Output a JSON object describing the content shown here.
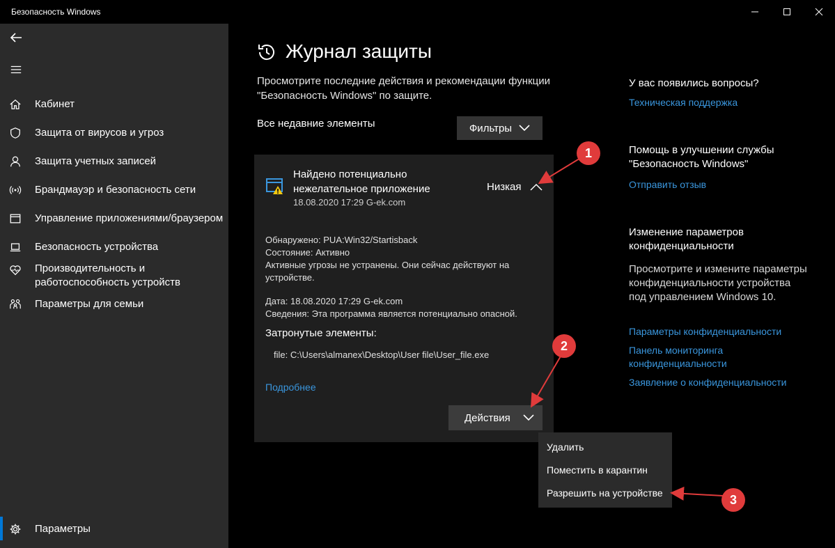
{
  "window": {
    "title": "Безопасность Windows"
  },
  "sidebar": {
    "items": [
      {
        "label": "Кабинет",
        "icon": "home-icon"
      },
      {
        "label": "Защита от вирусов и угроз",
        "icon": "shield-icon"
      },
      {
        "label": "Защита учетных записей",
        "icon": "person-icon"
      },
      {
        "label": "Брандмауэр и безопасность сети",
        "icon": "wifi-signal-icon"
      },
      {
        "label": "Управление приложениями/браузером",
        "icon": "app-window-icon"
      },
      {
        "label": "Безопасность устройства",
        "icon": "laptop-icon"
      },
      {
        "label": "Производительность и\nработоспособность устройств",
        "icon": "heart-icon"
      },
      {
        "label": "Параметры для семьи",
        "icon": "family-icon"
      }
    ],
    "settings_label": "Параметры"
  },
  "main": {
    "title": "Журнал защиты",
    "description": "Просмотрите последние действия и рекомендации функции \"Безопасность Windows\" по защите.",
    "recent_label": "Все недавние элементы",
    "filter_label": "Фильтры",
    "card": {
      "title": "Найдено потенциально нежелательное приложение",
      "date": "18.08.2020 17:29 G-ek.com",
      "severity": "Низкая",
      "detected": "Обнаружено: PUA:Win32/Startisback",
      "status": "Состояние: Активно",
      "threat_note": "Активные угрозы не устранены. Они сейчас действуют на устройстве.",
      "detail_date": "Дата: 18.08.2020 17:29 G-ek.com",
      "info": "Сведения: Эта программа является потенциально опасной.",
      "affected_title": "Затронутые элементы:",
      "file_path": "file: C:\\Users\\almanex\\Desktop\\User file\\User_file.exe",
      "more_link": "Подробнее",
      "actions_label": "Действия"
    },
    "actions_menu": [
      "Удалить",
      "Поместить в карантин",
      "Разрешить на устройстве"
    ]
  },
  "right": {
    "questions_heading": "У вас появились вопросы?",
    "support_link": "Техническая поддержка",
    "improve_heading": "Помощь в улучшении службы \"Безопасность Windows\"",
    "feedback_link": "Отправить отзыв",
    "privacy_heading": "Изменение параметров конфиденциальности",
    "privacy_text": "Просмотрите и измените параметры конфиденциальности устройства под управлением Windows 10.",
    "privacy_links": [
      "Параметры конфиденциальности",
      "Панель мониторинга конфиденциальности",
      "Заявление о конфиденциальности"
    ]
  },
  "annotations": [
    "1",
    "2",
    "3"
  ],
  "colors": {
    "accent": "#0078d7",
    "link": "#3a96dd",
    "badge": "#e03b3b",
    "warning": "#f2c811"
  }
}
